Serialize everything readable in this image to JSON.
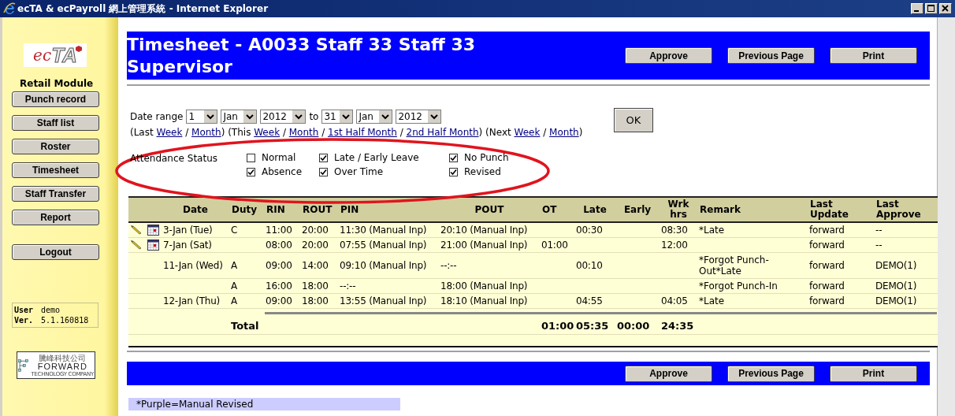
{
  "window": {
    "title": "ecTA & ecPayroll 網上管理系統 - Internet Explorer"
  },
  "sidebar": {
    "logo": {
      "prefix": "ec",
      "suffix": "TA"
    },
    "module_title": "Retail Module",
    "nav": [
      "Punch record",
      "Staff list",
      "Roster",
      "Timesheet",
      "Staff Transfer",
      "Report",
      "Logout"
    ],
    "user": {
      "user_label": "User",
      "user_value": "demo",
      "version_label": "Ver.",
      "version_value": "5.1.160818"
    },
    "company_logo": {
      "chinese": "騰峰科技公司",
      "name": "FORWARD",
      "tagline": "TECHNOLOGY COMPANY"
    }
  },
  "header": {
    "title": "Timesheet - A0033 Staff 33 Staff 33 Supervisor",
    "buttons": [
      "Approve",
      "Previous Page",
      "Print"
    ]
  },
  "date_range": {
    "label": "Date range",
    "from": [
      "1",
      "Jan",
      "2012"
    ],
    "to_label": "to",
    "to": [
      "31",
      "Jan",
      "2012"
    ],
    "ok": "OK"
  },
  "quick_ranges": [
    {
      "kind": "text",
      "text": "(Last "
    },
    {
      "kind": "link",
      "text": "Week"
    },
    {
      "kind": "text",
      "text": " / "
    },
    {
      "kind": "link",
      "text": "Month"
    },
    {
      "kind": "text",
      "text": ") (This "
    },
    {
      "kind": "link",
      "text": "Week"
    },
    {
      "kind": "text",
      "text": " / "
    },
    {
      "kind": "link",
      "text": "Month"
    },
    {
      "kind": "text",
      "text": " / "
    },
    {
      "kind": "link",
      "text": "1st Half Month"
    },
    {
      "kind": "text",
      "text": " / "
    },
    {
      "kind": "link",
      "text": "2nd Half Month"
    },
    {
      "kind": "text",
      "text": ") (Next "
    },
    {
      "kind": "link",
      "text": "Week"
    },
    {
      "kind": "text",
      "text": " / "
    },
    {
      "kind": "link",
      "text": "Month"
    },
    {
      "kind": "text",
      "text": ")"
    }
  ],
  "attendance": {
    "label": "Attendance Status",
    "options": [
      {
        "label": "Normal",
        "checked": false
      },
      {
        "label": "Late / Early Leave",
        "checked": true
      },
      {
        "label": "No Punch",
        "checked": true
      },
      {
        "label": "Absence",
        "checked": true
      },
      {
        "label": "Over Time",
        "checked": true
      },
      {
        "label": "Revised",
        "checked": true
      }
    ]
  },
  "table": {
    "columns": [
      "Date",
      "Duty",
      "RIN",
      "ROUT",
      "PIN",
      "POUT",
      "OT",
      "Late",
      "Early",
      "Wrk hrs",
      "Remark",
      "Last Update",
      "Last Approve"
    ],
    "rows": [
      {
        "editable": true,
        "cells": [
          "3-Jan (Tue)",
          "C",
          "11:00",
          "20:00",
          "11:30 (Manual Inp)",
          "20:10 (Manual Inp)",
          null,
          "00:30",
          null,
          "08:30",
          "*Late",
          "forward",
          "--"
        ]
      },
      {
        "editable": true,
        "cells": [
          "7-Jan (Sat)",
          null,
          "08:00",
          "20:00",
          "07:55 (Manual Inp)",
          "21:00 (Manual Inp)",
          "01:00",
          null,
          null,
          "12:00",
          null,
          "forward",
          "--"
        ]
      },
      {
        "editable": false,
        "cells": [
          "11-Jan (Wed)",
          "A",
          "09:00",
          "14:00",
          "09:10 (Manual Inp)",
          "--:--",
          null,
          "00:10",
          null,
          null,
          "*Forgot Punch-Out*Late",
          "forward",
          "DEMO(1)"
        ]
      },
      {
        "editable": false,
        "cells": [
          null,
          "A",
          "16:00",
          "18:00",
          "--:--",
          "18:00 (Manual Inp)",
          null,
          null,
          null,
          null,
          "*Forgot Punch-In",
          "forward",
          "DEMO(1)"
        ]
      },
      {
        "editable": false,
        "cells": [
          "12-Jan (Thu)",
          "A",
          "09:00",
          "18:00",
          "13:55 (Manual Inp)",
          "18:10 (Manual Inp)",
          null,
          "04:55",
          null,
          "04:05",
          "*Late",
          "forward",
          "DEMO(1)"
        ]
      }
    ],
    "total": {
      "label": "Total",
      "ot": "01:00",
      "late": "05:35",
      "early": "00:00",
      "wrk": "24:35"
    }
  },
  "footer": {
    "buttons": [
      "Approve",
      "Previous Page",
      "Print"
    ]
  },
  "legend": "*Purple=Manual Revised"
}
